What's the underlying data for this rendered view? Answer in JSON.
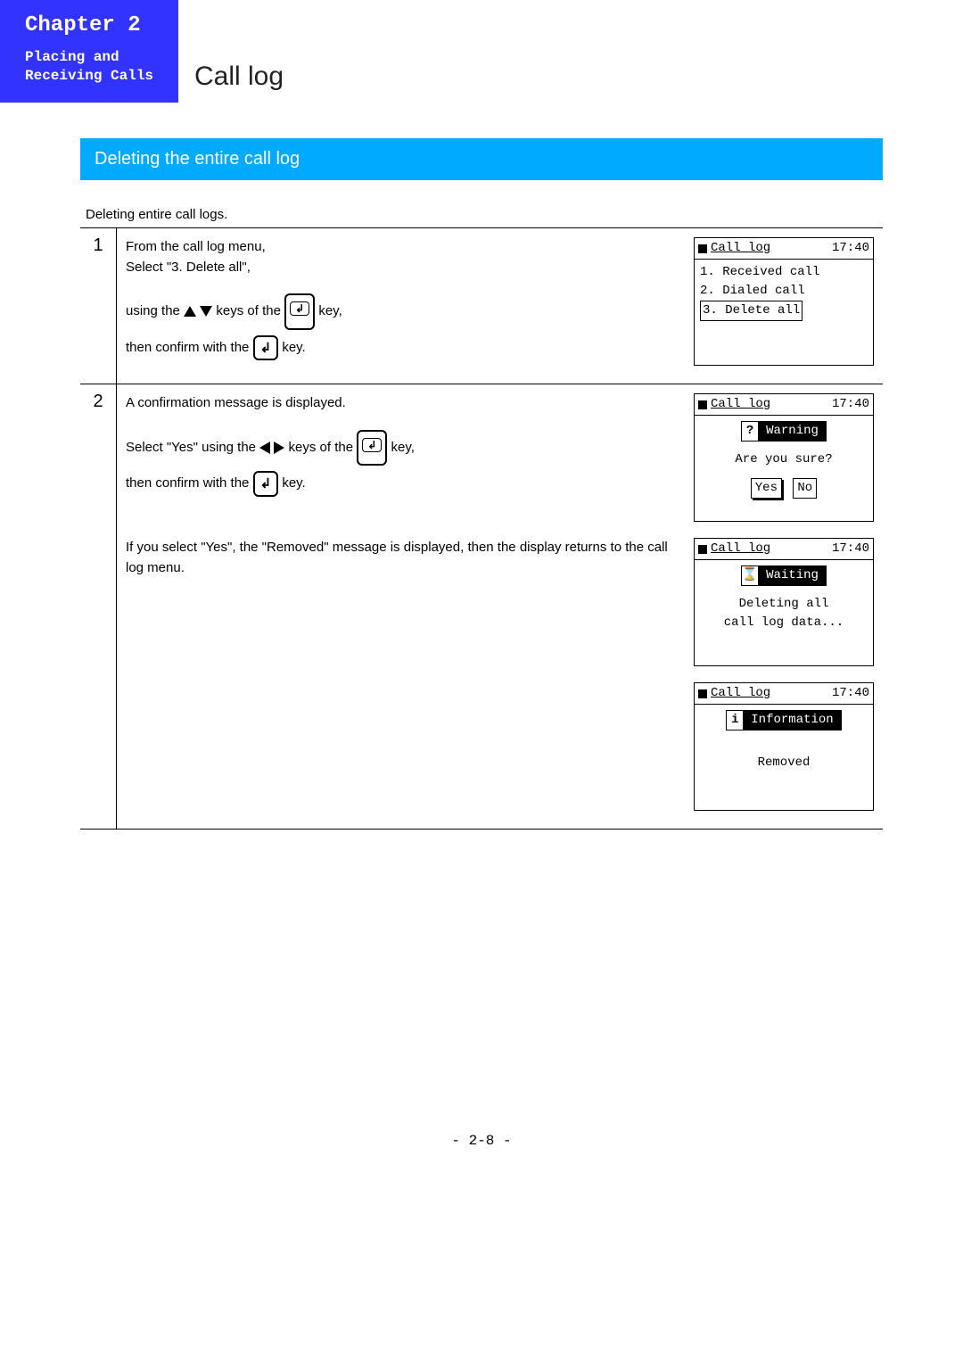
{
  "header": {
    "chapter": "Chapter 2",
    "subtitle_line1": "Placing and",
    "subtitle_line2": "Receiving Calls",
    "page_title": "Call log"
  },
  "section": {
    "title": "Deleting the entire call log",
    "intro": "Deleting entire call logs."
  },
  "steps": {
    "s1": {
      "num": "1",
      "line1": "From the call log menu,",
      "line2": "Select \"3. Delete all\",",
      "line3_a": "using the ",
      "line3_b": " keys of the ",
      "line3_c": " key,",
      "line4_a": "then confirm with the ",
      "line4_b": " key.",
      "lcd": {
        "title": "Call log",
        "time": "17:40",
        "item1": "1. Received call",
        "item2": "2. Dialed call",
        "item3": "3. Delete all"
      }
    },
    "s2": {
      "num": "2",
      "p1_line1": "A confirmation message is displayed.",
      "p1_line2_a": "Select \"Yes\" using the ",
      "p1_line2_b": " keys of the ",
      "p1_line2_c": " key,",
      "p1_line3_a": "then confirm with the ",
      "p1_line3_b": " key.",
      "p2": "If you select \"Yes\", the \"Removed\" message is displayed, then the display returns to the call log menu.",
      "lcd_warn": {
        "title": "Call log",
        "time": "17:40",
        "pill": "Warning",
        "msg": "Are you sure?",
        "yes": "Yes",
        "no": "No"
      },
      "lcd_wait": {
        "title": "Call log",
        "time": "17:40",
        "pill": "Waiting",
        "msg1": "Deleting all",
        "msg2": "call log data..."
      },
      "lcd_info": {
        "title": "Call log",
        "time": "17:40",
        "pill": "Information",
        "msg": "Removed"
      }
    }
  },
  "footer": "- 2-8 -"
}
